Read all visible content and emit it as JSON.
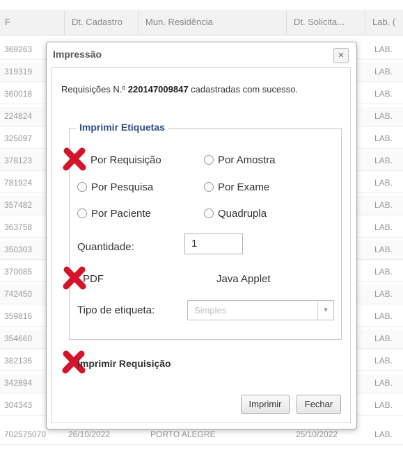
{
  "grid": {
    "columns": [
      {
        "label": "F"
      },
      {
        "label": "Dt. Cadastro"
      },
      {
        "label": "Mun. Residência"
      },
      {
        "label": "Dt. Solicita..."
      },
      {
        "label": "Lab. ("
      }
    ],
    "rows": [
      {
        "id": "369263",
        "lab": "LAB."
      },
      {
        "id": "319319",
        "lab": "LAB."
      },
      {
        "id": "360018",
        "lab": "LAB."
      },
      {
        "id": "224824",
        "lab": "LAB."
      },
      {
        "id": "325097",
        "lab": "LAB."
      },
      {
        "id": "378123",
        "lab": "LAB."
      },
      {
        "id": "781924",
        "lab": "LAB."
      },
      {
        "id": "357482",
        "lab": "LAB."
      },
      {
        "id": "363758",
        "lab": "LAB."
      },
      {
        "id": "350303",
        "lab": "LAB."
      },
      {
        "id": "370085",
        "lab": "LAB."
      },
      {
        "id": "742450",
        "lab": "LAB."
      },
      {
        "id": "359816",
        "lab": "LAB."
      },
      {
        "id": "354660",
        "lab": "LAB."
      },
      {
        "id": "382136",
        "lab": "LAB."
      },
      {
        "id": "342894",
        "lab": "LAB."
      },
      {
        "id": "304343",
        "lab": "LAB."
      }
    ],
    "last_row": {
      "id": "702575070",
      "dt_cadastro": "26/10/2022",
      "municipio": "PORTO ALEGRE",
      "dt_solicitacao": "25/10/2022",
      "lab": "LAB."
    }
  },
  "dialog": {
    "title": "Impressão",
    "close_label": "×",
    "message_prefix": "Requisições N.º ",
    "message_number": "220147009847",
    "message_suffix": " cadastradas com sucesso.",
    "group_label": "Imprimir Etiquetas",
    "options": {
      "por_requisicao": "Por Requisição",
      "por_amostra": "Por Amostra",
      "por_pesquisa": "Por Pesquisa",
      "por_exame": "Por Exame",
      "por_paciente": "Por Paciente",
      "quadrupla": "Quadrupla"
    },
    "quantidade_label": "Quantidade:",
    "quantidade_value": "1",
    "pdf_label": "PDF",
    "java_label": "Java Applet",
    "tipo_label": "Tipo de etiqueta:",
    "tipo_value": "Simples",
    "imprimir_requisicao_label": "Imprimir Requisição",
    "imprimir_button": "Imprimir",
    "fechar_button": "Fechar"
  },
  "colors": {
    "annotation_x": "#d4142a",
    "legend": "#2d4f8a"
  }
}
